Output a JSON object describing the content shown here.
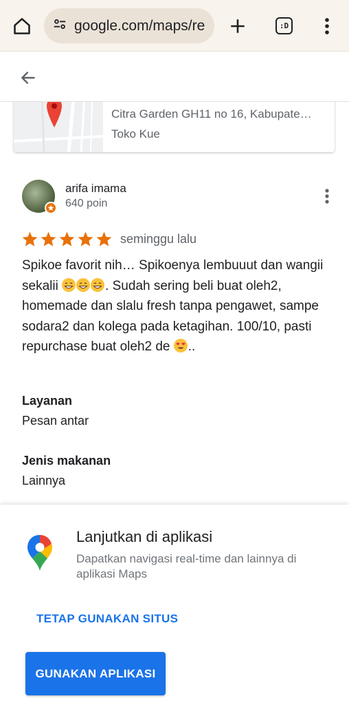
{
  "browser": {
    "url": "google.com/maps/re",
    "tabs_label": ":D"
  },
  "place": {
    "address": "Citra Garden GH11 no 16, Kabupate…",
    "category": "Toko Kue"
  },
  "review": {
    "author": "arifa imama",
    "points": "640 poin",
    "rating": 5,
    "time": "seminggu lalu",
    "text_1": "Spikoe favorit nih… Spikoenya lembuuut  dan wangii sekalii ",
    "text_2": ". Sudah sering beli buat oleh2, homemade dan slalu fresh tanpa pengawet, sampe sodara2 dan kolega pada ketagihan. 100/10, pasti repurchase buat oleh2 de ",
    "text_3": ".."
  },
  "attributes": [
    {
      "title": "Layanan",
      "value": "Pesan antar"
    },
    {
      "title": "Jenis makanan",
      "value": "Lainnya"
    }
  ],
  "sheet": {
    "title": "Lanjutkan di aplikasi",
    "description": "Dapatkan navigasi real-time dan lainnya di aplikasi Maps",
    "stay_label": "TETAP GUNAKAN SITUS",
    "use_app_label": "GUNAKAN APLIKASI"
  },
  "colors": {
    "star": "#e8710a",
    "accent": "#1a73e8"
  }
}
